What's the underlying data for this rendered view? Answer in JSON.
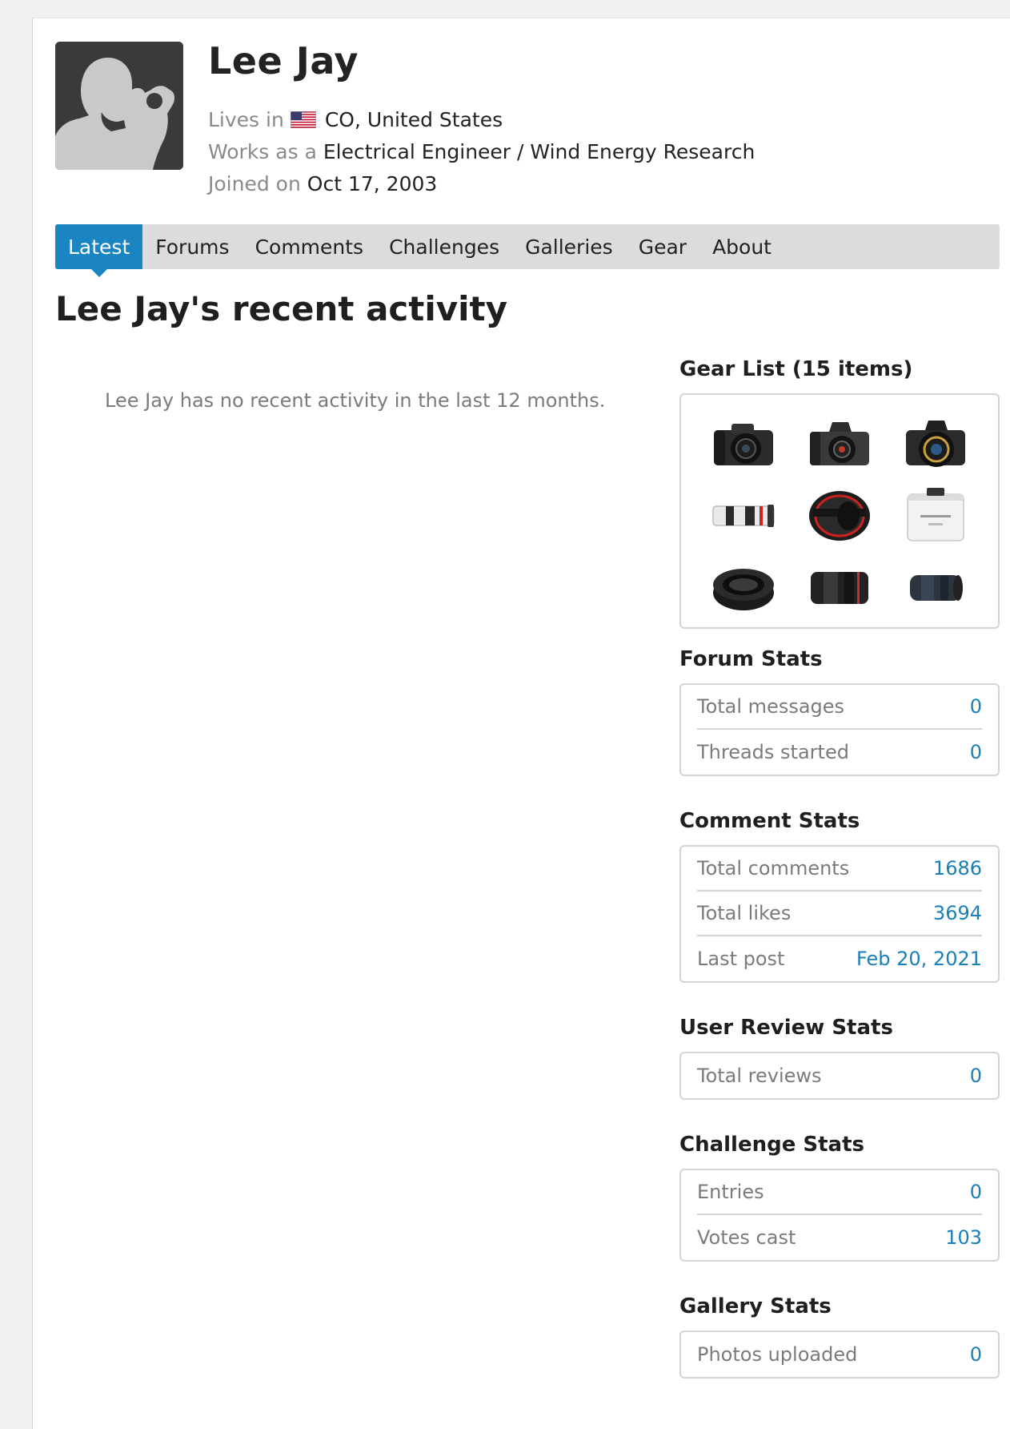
{
  "profile": {
    "name": "Lee Jay",
    "lives_in_label": "Lives in",
    "location": "CO, United States",
    "works_as_label": "Works as a",
    "occupation": "Electrical Engineer / Wind Energy Research",
    "joined_label": "Joined on",
    "joined_date": "Oct 17, 2003"
  },
  "tabs": [
    {
      "label": "Latest",
      "active": true
    },
    {
      "label": "Forums"
    },
    {
      "label": "Comments"
    },
    {
      "label": "Challenges"
    },
    {
      "label": "Galleries"
    },
    {
      "label": "Gear"
    },
    {
      "label": "About"
    }
  ],
  "main": {
    "title": "Lee Jay's recent activity",
    "empty_message": "Lee Jay has no recent activity in the last 12 months."
  },
  "sidebar": {
    "gear": {
      "title": "Gear List (15 items)",
      "items": [
        "camera-icon",
        "camera-icon",
        "camera-icon",
        "telephoto-lens-icon",
        "wide-lens-icon",
        "teleconverter-icon",
        "extension-tube-icon",
        "zoom-lens-icon",
        "zoom-lens-icon"
      ]
    },
    "forum_stats": {
      "title": "Forum Stats",
      "rows": [
        {
          "label": "Total messages",
          "value": "0"
        },
        {
          "label": "Threads started",
          "value": "0"
        }
      ]
    },
    "comment_stats": {
      "title": "Comment Stats",
      "rows": [
        {
          "label": "Total comments",
          "value": "1686"
        },
        {
          "label": "Total likes",
          "value": "3694"
        },
        {
          "label": "Last post",
          "value": "Feb 20, 2021"
        }
      ]
    },
    "review_stats": {
      "title": "User Review Stats",
      "rows": [
        {
          "label": "Total reviews",
          "value": "0"
        }
      ]
    },
    "challenge_stats": {
      "title": "Challenge Stats",
      "rows": [
        {
          "label": "Entries",
          "value": "0"
        },
        {
          "label": "Votes cast",
          "value": "103"
        }
      ]
    },
    "gallery_stats": {
      "title": "Gallery Stats",
      "rows": [
        {
          "label": "Photos uploaded",
          "value": "0"
        }
      ]
    }
  },
  "colors": {
    "accent": "#1a85c0",
    "link": "#1a7fb8",
    "tab_bar": "#dcdcdc"
  }
}
